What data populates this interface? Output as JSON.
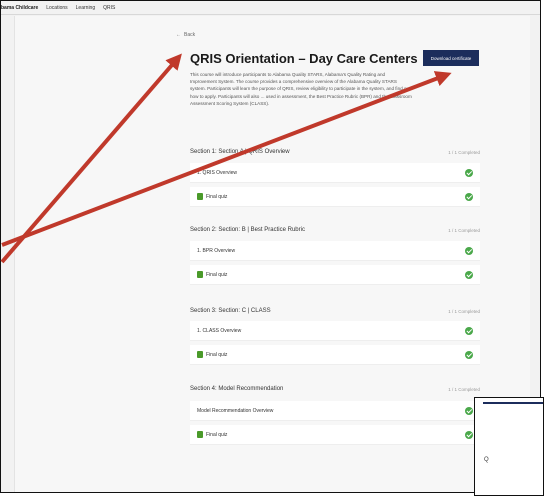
{
  "nav": {
    "brand": "bama Childcare",
    "items": [
      "Locations",
      "Learning",
      "QRIS"
    ]
  },
  "course": {
    "back_label": "Back",
    "back_icon": "arrow-left-icon",
    "title": "QRIS Orientation – Day Care Centers",
    "description": "This course will introduce participants to Alabama Quality STARS, Alabama's Quality Rating and Improvement System. The course provides a comprehensive overview of the Alabama Quality STARS system. Participants will learn the purpose of QRIS, review eligibility to participate in the system, and find out how to apply. Participants will also ... used in assessment, the Best Practice Rubric (BPR) and the Classroom Assessment Scoring System (CLASS).",
    "download_label": "Download certificate"
  },
  "sections": [
    {
      "title": "Section 1: Section A | QRIS Overview",
      "completed": "1 / 1 Completed",
      "items": [
        {
          "label": "1. QRIS Overview",
          "type": "lesson"
        },
        {
          "label": "Final quiz",
          "type": "quiz"
        }
      ]
    },
    {
      "title": "Section 2: Section: B | Best Practice Rubric",
      "completed": "1 / 1 Completed",
      "items": [
        {
          "label": "1. BPR Overview",
          "type": "lesson"
        },
        {
          "label": "Final quiz",
          "type": "quiz"
        }
      ]
    },
    {
      "title": "Section 3: Section: C | CLASS",
      "completed": "1 / 1 Completed",
      "items": [
        {
          "label": "1. CLASS Overview",
          "type": "lesson"
        },
        {
          "label": "Final quiz",
          "type": "quiz"
        }
      ]
    },
    {
      "title": "Section 4: Model Recommendation",
      "completed": "1 / 1 Completed",
      "items": [
        {
          "label": "Model Recommendation Overview",
          "type": "lesson"
        },
        {
          "label": "Final quiz",
          "type": "quiz"
        }
      ]
    }
  ],
  "inset": {
    "text": "Q"
  },
  "colors": {
    "accent": "#1c2d5c",
    "check": "#4aa84a",
    "annotation_arrow": "#c0392b"
  }
}
